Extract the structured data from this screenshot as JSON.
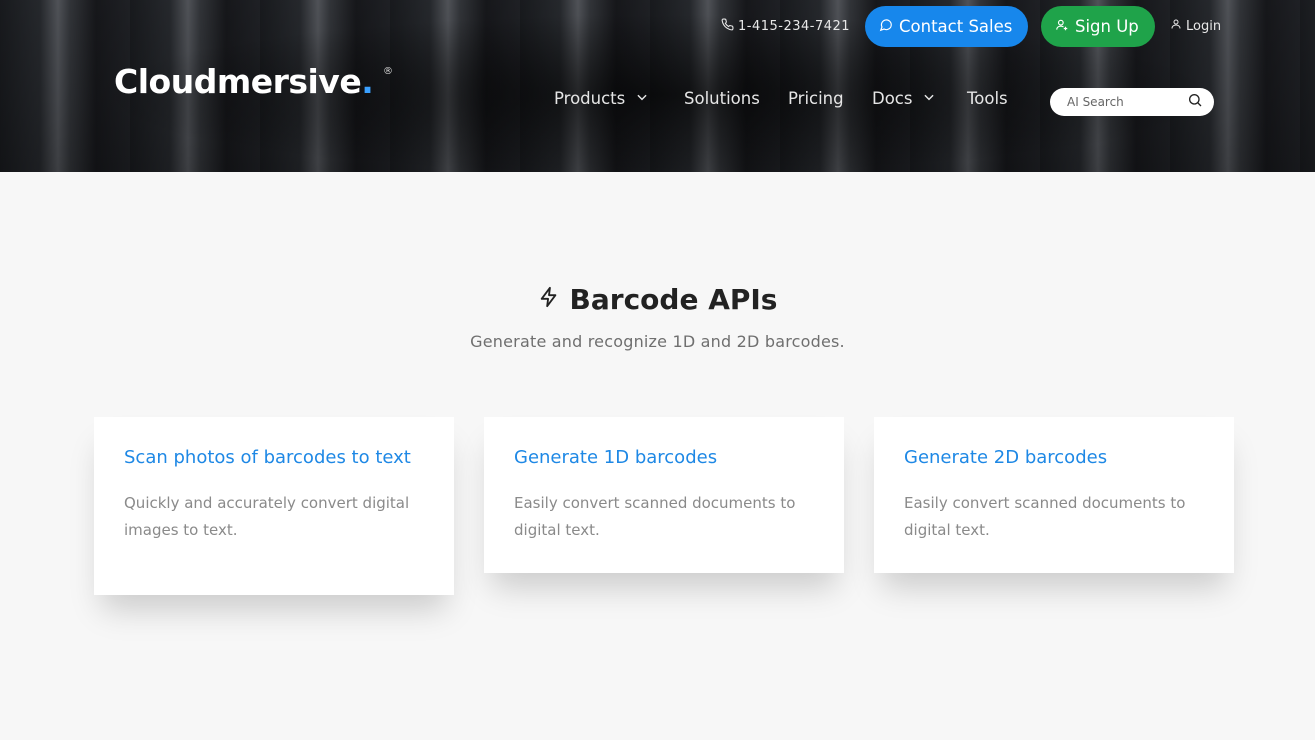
{
  "header": {
    "logo_text": "Cloudmersive",
    "logo_dot": ".",
    "logo_reg": "®",
    "phone": "1-415-234-7421",
    "contact_label": "Contact Sales",
    "signup_label": "Sign Up",
    "login_label": "Login",
    "nav": {
      "products": "Products",
      "solutions": "Solutions",
      "pricing": "Pricing",
      "docs": "Docs",
      "tools": "Tools"
    },
    "search": {
      "placeholder": "AI Search"
    }
  },
  "section": {
    "title": "Barcode APIs",
    "subtitle": "Generate and recognize 1D and 2D barcodes."
  },
  "cards": [
    {
      "title": "Scan photos of barcodes to text",
      "description": "Quickly and accurately convert digital images to text."
    },
    {
      "title": "Generate 1D barcodes",
      "description": "Easily convert scanned documents to digital text."
    },
    {
      "title": "Generate 2D barcodes",
      "description": "Easily convert scanned documents to digital text."
    }
  ],
  "colors": {
    "brand_blue": "#1787ec",
    "signup_green": "#1fa34a",
    "card_title_blue": "#1e88e5"
  },
  "icons": {
    "phone": "phone-icon",
    "chat": "chat-icon",
    "user_plus": "user-plus-icon",
    "user": "user-icon",
    "chevron": "chevron-down-icon",
    "search": "search-icon",
    "bolt": "bolt-icon"
  }
}
